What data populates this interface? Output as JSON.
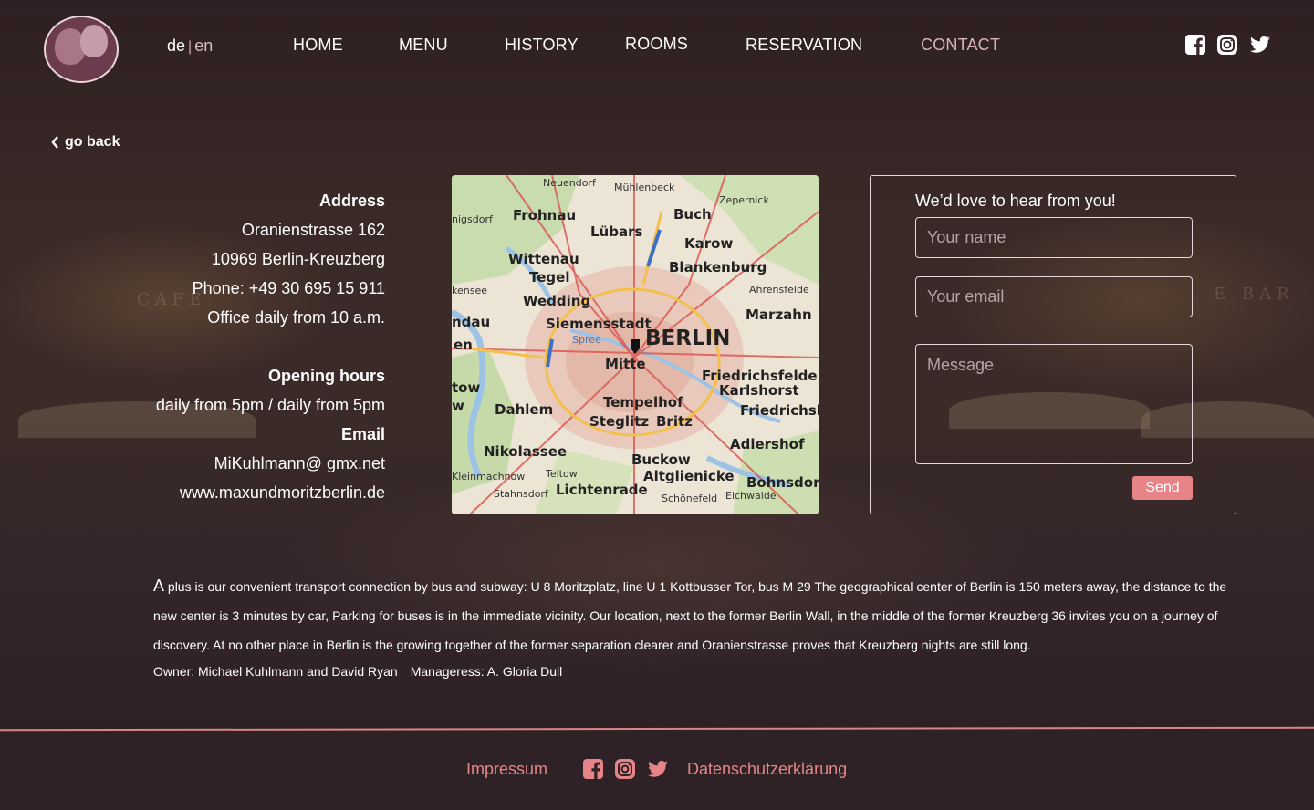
{
  "header": {
    "lang_de": "de",
    "lang_sep": "|",
    "lang_en": "en",
    "nav": {
      "home": "HOME",
      "menu": "MENU",
      "history": "HISTORY",
      "rooms": "ROOMS",
      "reservation": "RESERVATION",
      "contact": "CONTACT"
    },
    "social_icons": [
      "facebook-icon",
      "instagram-icon",
      "twitter-icon"
    ]
  },
  "go_back": "go back",
  "info": {
    "address_heading": "Address",
    "street": "Oranienstrasse 162",
    "city": "10969 Berlin-Kreuzberg",
    "phone": "Phone: +49 30 695 15 911",
    "office": "Office daily from 10 a.m.",
    "hours_heading": "Opening hours",
    "hours": "daily from 5pm / daily from 5pm",
    "email_heading": "Email",
    "email": "MiKuhlmann@ gmx.net",
    "website": "www.maxundmoritzberlin.de"
  },
  "map": {
    "labels": [
      "Neuendorf",
      "Mühlenbeck",
      "Zepernick",
      "nigsdorf",
      "Frohnau",
      "Buch",
      "Lübars",
      "Karow",
      "Wittenau",
      "Blankenburg",
      "Tegel",
      "kensee",
      "Ahrensfelde",
      "Wedding",
      "ndau",
      "Marzahn",
      "Siemensstadt",
      "BERLIN",
      "en",
      "Spree",
      "Mitte",
      "Friedrichsfelde",
      "tow",
      "Karlshorst",
      "Tempelhof",
      "Dahlem",
      "Friedrichsh",
      "Steglitz",
      "Britz",
      "Adlershof",
      "Nikolassee",
      "Buckow",
      "Kleinmachnow",
      "Teltow",
      "Altglienicke",
      "Bohnsdorf",
      "Stahnsdorf",
      "Lichtenrade",
      "Schönefeld",
      "Eichwalde",
      "w"
    ]
  },
  "form": {
    "title": "We’d love to hear from you!",
    "name_placeholder": "Your name",
    "email_placeholder": "Your email",
    "message_placeholder": "Message",
    "send_label": "Send"
  },
  "paragraph": {
    "initial": "A",
    "text": " plus is our convenient transport connection by bus and subway: U 8 Moritzplatz, line U 1 Kottbusser Tor, bus M 29 The geographical center of Berlin is 150 meters away, the distance to the new center is 3 minutes by car, Parking for buses is in the immediate vicinity. Our location, next to the former Berlin Wall, in the middle of the former Kreuzberg 36 invites you on a journey of discovery. At no other place in Berlin is the growing together of the former separation clearer and Oranienstrasse proves that Kreuzberg nights are still long."
  },
  "owners": {
    "owner": "Owner: Michael Kuhlmann and David Ryan",
    "manager": "Manageress: A. Gloria Dull"
  },
  "footer": {
    "impressum": "Impressum",
    "datenschutz": "Datenschutzerklärung"
  },
  "colors": {
    "accent": "#e78487",
    "background": "#2f2124",
    "nav_active": "#d8b6bc"
  }
}
